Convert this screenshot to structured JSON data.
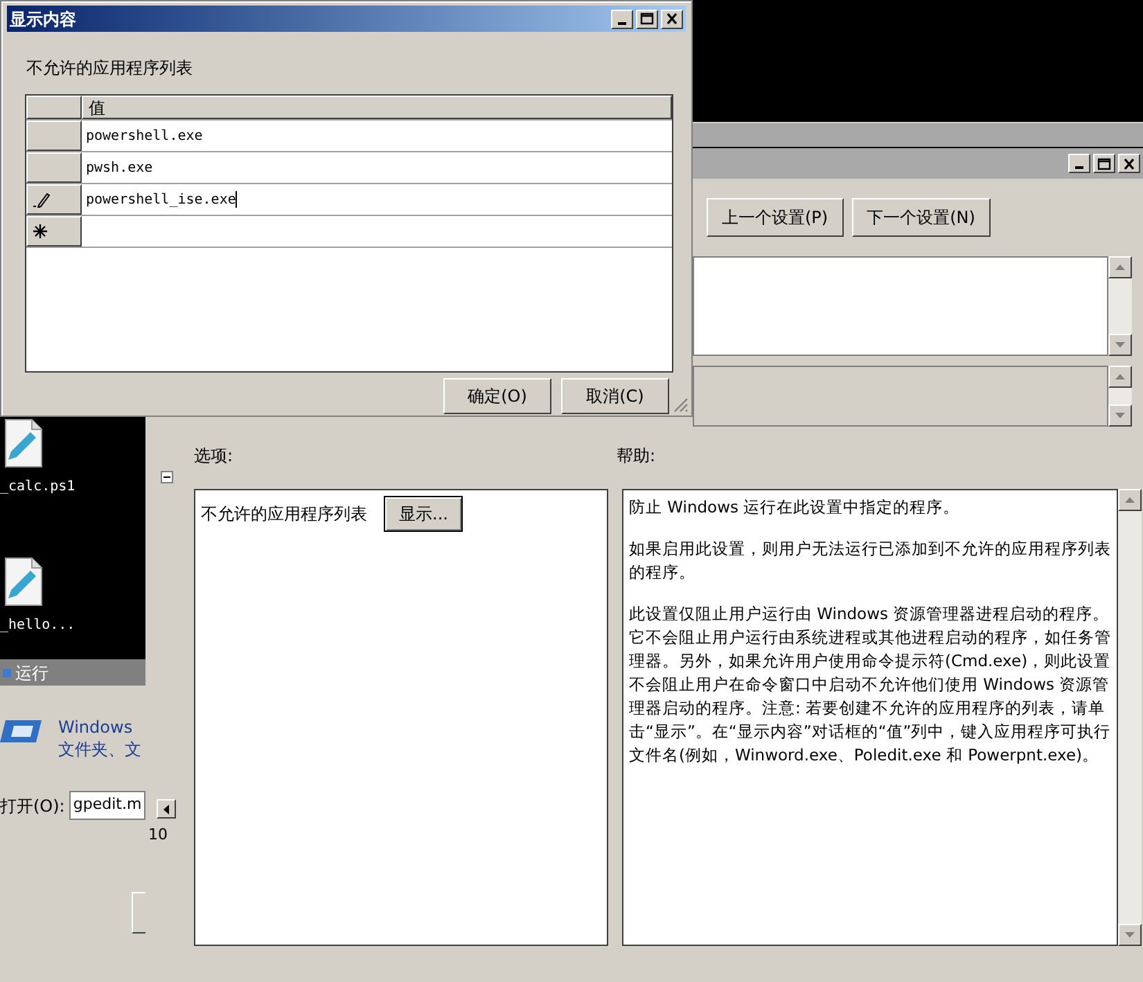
{
  "dialog": {
    "title": "显示内容",
    "label": "不允许的应用程序列表",
    "grid": {
      "columns": [
        "值"
      ],
      "rows": [
        {
          "kind": "entry",
          "value": "powershell.exe",
          "editing": false
        },
        {
          "kind": "entry",
          "value": "pwsh.exe",
          "editing": false
        },
        {
          "kind": "entry",
          "value": "powershell_ise.exe",
          "editing": true
        },
        {
          "kind": "new"
        }
      ]
    },
    "buttons": [
      "确定(O)",
      "取消(C)"
    ]
  },
  "desktop": {
    "icons": [
      {
        "label": "_calc.ps1"
      },
      {
        "label": "_hello..."
      }
    ]
  },
  "run_dialog": {
    "title": "运行",
    "description": [
      "Windows",
      "文件夹、文"
    ],
    "open_label": "打开(O):",
    "open_value": "gpedit.m"
  },
  "settings_window": {
    "nav_buttons": [
      "上一个设置(P)",
      "下一个设置(N)"
    ],
    "zoom_value": "10",
    "options_label": "选项:",
    "help_label": "帮助:",
    "option": {
      "label": "不允许的应用程序列表",
      "button": "显示..."
    },
    "help_paragraphs": [
      "防止 Windows 运行在此设置中指定的程序。",
      "如果启用此设置，则用户无法运行已添加到不允许的应用程序列表的程序。",
      "此设置仅阻止用户运行由 Windows 资源管理器进程启动的程序。它不会阻止用户运行由系统进程或其他进程启动的程序，如任务管理器。另外，如果允许用户使用命令提示符(Cmd.exe)，则此设置不会阻止用户在命令窗口中启动不允许他们使用 Windows 资源管理器启动的程序。注意: 若要创建不允许的应用程序的列表，请单击“显示”。在“显示内容”对话框的“值”列中，键入应用程序可执行文件名(例如，Winword.exe、Poledit.exe 和 Powerpnt.exe)。"
    ]
  }
}
